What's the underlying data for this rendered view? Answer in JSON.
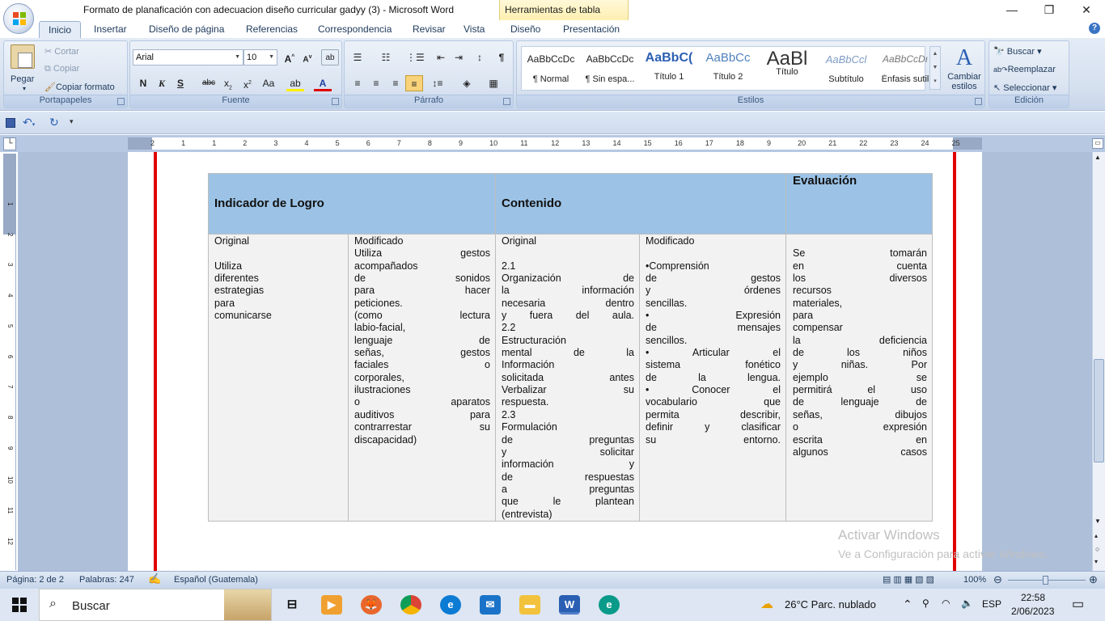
{
  "window": {
    "title": "Formato de planaficación con adecuacion diseño curricular gadyy (3) - Microsoft Word",
    "context_tab": "Herramientas de tabla"
  },
  "tabs": [
    "Inicio",
    "Insertar",
    "Diseño de página",
    "Referencias",
    "Correspondencia",
    "Revisar",
    "Vista",
    "Diseño",
    "Presentación"
  ],
  "ribbon": {
    "clipboard": {
      "paste": "Pegar",
      "cut": "Cortar",
      "copy": "Copiar",
      "format_painter": "Copiar formato",
      "label": "Portapapeles"
    },
    "font": {
      "name": "Arial",
      "size": "10",
      "label": "Fuente"
    },
    "paragraph": {
      "label": "Párrafo"
    },
    "styles": {
      "items": [
        {
          "preview": "AaBbCcDc",
          "name": "¶ Normal"
        },
        {
          "preview": "AaBbCcDc",
          "name": "¶ Sin espa..."
        },
        {
          "preview": "AaBbC(",
          "name": "Título 1"
        },
        {
          "preview": "AaBbCc",
          "name": "Título 2"
        },
        {
          "preview": "AaBl",
          "name": "Título"
        },
        {
          "preview": "AaBbCcl",
          "name": "Subtítulo"
        },
        {
          "preview": "AaBbCcDı",
          "name": "Énfasis sutil"
        }
      ],
      "change": "Cambiar estilos",
      "label": "Estilos"
    },
    "editing": {
      "find": "Buscar",
      "replace": "Reemplazar",
      "select": "Seleccionar",
      "label": "Edición"
    }
  },
  "ruler": {
    "marks": [
      "2",
      "1",
      "1",
      "2",
      "3",
      "4",
      "5",
      "6",
      "7",
      "8",
      "9",
      "10",
      "11",
      "12",
      "13",
      "14",
      "15",
      "16",
      "17",
      "18",
      "9",
      "20",
      "21",
      "22",
      "23",
      "24",
      "25"
    ],
    "vmarks": [
      "1",
      "2",
      "3",
      "4",
      "5",
      "6",
      "7",
      "8",
      "9",
      "10",
      "11",
      "12"
    ]
  },
  "table": {
    "headers": {
      "indicador": "Indicador de Logro",
      "contenido": "Contenido",
      "evaluacion": "Evaluación"
    },
    "col1": [
      "Original",
      "",
      "Utiliza",
      "diferentes",
      "estrategias",
      "para",
      "comunicarse"
    ],
    "col2": [
      "Modificado",
      "Utiliza gestos",
      "acompañados",
      "de sonidos",
      "para hacer",
      "peticiones.",
      "(como lectura",
      "labio-facial,",
      "lenguaje de",
      "señas, gestos",
      "faciales o",
      "corporales,",
      "ilustraciones",
      "o aparatos",
      "auditivos para",
      "contrarrestar su",
      "discapacidad)"
    ],
    "col3": [
      "Original",
      "",
      "2.1",
      "Organización de",
      "la información",
      "necesaria dentro",
      "y fuera del aula.",
      "2.2",
      "Estructuración",
      "mental de la",
      "Información",
      "solicitada antes",
      "Verbalizar su",
      "respuesta.",
      "2.3",
      "Formulación",
      "de preguntas",
      "y solicitar",
      "información y",
      "de respuestas",
      "a preguntas",
      "que le plantean",
      "(entrevista)"
    ],
    "col4": [
      "Modificado",
      "",
      "•Comprensión",
      "de gestos",
      "y órdenes",
      "sencillas.",
      "• Expresión",
      "de mensajes",
      "sencillos.",
      "• Articular el",
      "sistema fonético",
      "de la lengua.",
      "• Conocer el",
      "vocabulario que",
      "permita describir,",
      "definir y clasificar",
      "su entorno."
    ],
    "col5": [
      "",
      "Se tomarán",
      "en cuenta",
      "los diversos",
      "recursos",
      "materiales,",
      "para",
      "compensar",
      "la deficiencia",
      "de los niños",
      "y niñas. Por",
      "ejemplo se",
      "permitirá el uso",
      "de lenguaje de",
      "señas, dibujos",
      "o expresión",
      "escrita en",
      "algunos casos"
    ]
  },
  "watermark": {
    "line1": "Activar Windows",
    "line2": "Ve a Configuración para activar Windows."
  },
  "status": {
    "page": "Página: 2 de 2",
    "words": "Palabras: 247",
    "language": "Español (Guatemala)",
    "zoom": "100%"
  },
  "taskbar": {
    "search": "Buscar",
    "weather": "26°C  Parc. nublado",
    "lang": "ESP",
    "time": "22:58",
    "date": "2/06/2023"
  }
}
